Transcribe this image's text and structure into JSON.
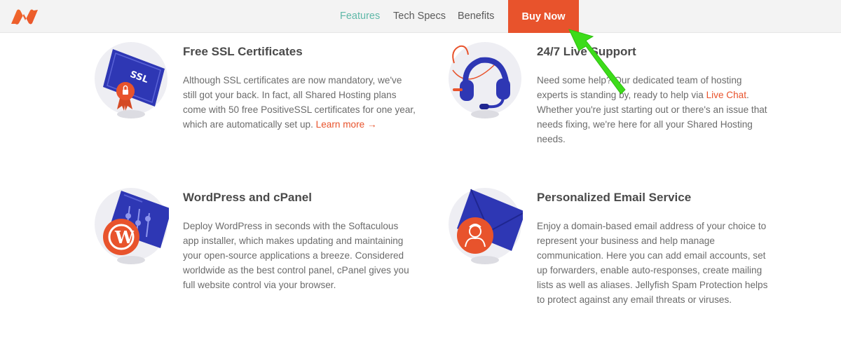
{
  "nav": {
    "links": [
      "Features",
      "Tech Specs",
      "Benefits"
    ],
    "buy_now": "Buy Now"
  },
  "features": [
    {
      "title": "Free SSL Certificates",
      "icon": "ssl-certificate-icon",
      "icon_text": "SSL",
      "desc_lines": [
        "Although SSL certificates are now mandatory, we've",
        "still got your back. In fact, all Shared Hosting plans",
        "come with 50 free PositiveSSL certificates for one year,"
      ],
      "desc_last_prefix": "which are automatically set up. ",
      "link": "Learn more →"
    },
    {
      "title": "24/7 Live Support",
      "icon": "headset-icon",
      "desc_first_prefix": "Need some help? Our dedicated team of hosting",
      "desc_line2_prefix": "experts is standing by, ready to help via ",
      "link": "Live Chat",
      "desc_line2_suffix": ".",
      "desc_lines_after": [
        "Whether you're just starting out or there's an issue that",
        "needs fixing, we're here for all your Shared Hosting",
        "needs."
      ]
    },
    {
      "title": "WordPress and cPanel",
      "icon": "wordpress-icon",
      "desc_lines": [
        "Deploy WordPress in seconds with the Softaculous",
        "app installer, which makes updating and maintaining",
        "your open-source applications a breeze. Considered",
        "worldwide as the best control panel, cPanel gives you",
        "full website control via your browser."
      ]
    },
    {
      "title": "Personalized Email Service",
      "icon": "email-envelope-icon",
      "desc_lines": [
        "Enjoy a domain-based email address of your choice to",
        "represent your business and help manage",
        "communication. Here you can add email accounts, set",
        "up forwarders, enable auto-responses, create mailing",
        "lists as well as aliases. Jellyfish Spam Protection helps",
        "to protect against any email threats or viruses."
      ]
    }
  ],
  "colors": {
    "accent": "#e8532c",
    "nav_active": "#5fb8a8",
    "icon_blue": "#2e37b4",
    "annotation_arrow": "#3ddc1a"
  }
}
